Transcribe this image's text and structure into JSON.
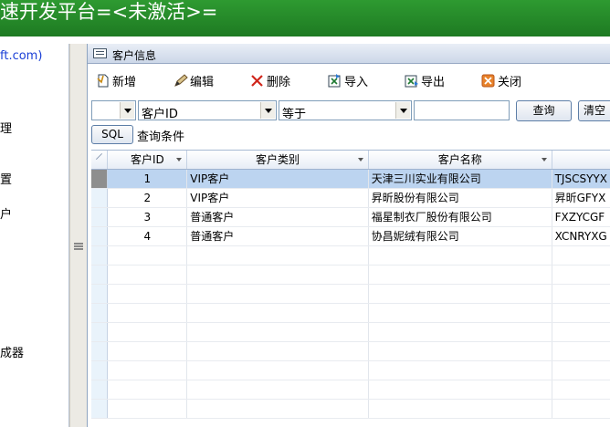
{
  "app": {
    "title": "速开发平台=<未激活>="
  },
  "left_panel": {
    "items": [
      {
        "label": "ft.com)",
        "kind": "link"
      },
      {
        "label": "理"
      },
      {
        "label": "置"
      },
      {
        "label": "户"
      },
      {
        "label": "成器"
      }
    ]
  },
  "window": {
    "title": "客户信息"
  },
  "toolbar": {
    "buttons": [
      {
        "label": "新增",
        "icon": "new-doc-icon"
      },
      {
        "label": "编辑",
        "icon": "edit-pen-icon"
      },
      {
        "label": "删除",
        "icon": "delete-x-icon",
        "icon_color": "#d0261b"
      },
      {
        "label": "导入",
        "icon": "import-excel-icon"
      },
      {
        "label": "导出",
        "icon": "export-excel-icon"
      },
      {
        "label": "关闭",
        "icon": "close-box-icon",
        "icon_color": "#e8822a"
      }
    ]
  },
  "filter": {
    "logic_value": "",
    "field_value": "客户ID",
    "operator_value": "等于",
    "search_value": "",
    "query_label": "查询",
    "clear_label": "清空"
  },
  "sql": {
    "button_label": "SQL",
    "condition_label": "查询条件"
  },
  "grid": {
    "columns": [
      "客户ID",
      "客户类别",
      "客户名称",
      ""
    ],
    "rows": [
      {
        "id": "1",
        "category": "VIP客户",
        "name": "天津三川实业有限公司",
        "code": "TJSCSYYX",
        "selected": true
      },
      {
        "id": "2",
        "category": "VIP客户",
        "name": "昇昕股份有限公司",
        "code": "昇昕GFYX"
      },
      {
        "id": "3",
        "category": "普通客户",
        "name": "福星制衣厂股份有限公司",
        "code": "FXZYCGF"
      },
      {
        "id": "4",
        "category": "普通客户",
        "name": "协昌妮绒有限公司",
        "code": "XCNRYXG"
      }
    ],
    "selection_color": "#bcd4f0"
  },
  "colors": {
    "title_bar": "#1e7a22",
    "link": "#1a3fd6"
  }
}
